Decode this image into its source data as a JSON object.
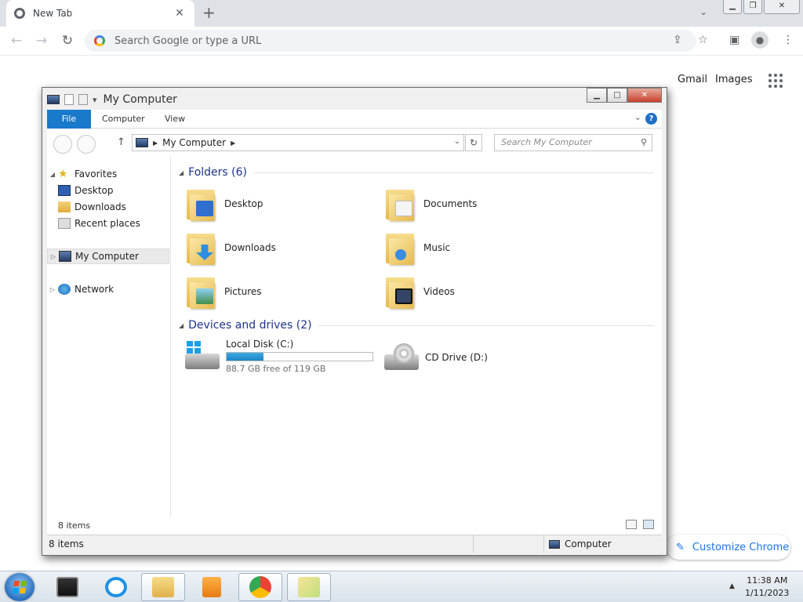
{
  "browser": {
    "tab_title": "New Tab",
    "tab_close": "✕",
    "new_tab": "+",
    "omnibox_placeholder": "Search Google or type a URL",
    "links": {
      "gmail": "Gmail",
      "images": "Images"
    },
    "customize": "Customize Chrome"
  },
  "explorer": {
    "title": "My Computer",
    "ribbon_tabs": [
      "File",
      "Computer",
      "View"
    ],
    "help": "?",
    "address": "My Computer",
    "search_placeholder": "Search My Computer",
    "nav": {
      "favorites": "Favorites",
      "desktop": "Desktop",
      "downloads": "Downloads",
      "recent": "Recent places",
      "computer": "My Computer",
      "network": "Network"
    },
    "folders_header": "Folders (6)",
    "folders": [
      {
        "name": "Desktop",
        "color": "#2f6fd0"
      },
      {
        "name": "Documents",
        "color": "#f5f5f5"
      },
      {
        "name": "Downloads",
        "color": "#2d8fe0"
      },
      {
        "name": "Music",
        "color": "#3a8de0"
      },
      {
        "name": "Pictures",
        "color": "#5aa8e8"
      },
      {
        "name": "Videos",
        "color": "#334466"
      }
    ],
    "drives_header": "Devices and drives (2)",
    "drives": [
      {
        "name": "Local Disk (C:)",
        "free": "88.7 GB free of 119 GB",
        "used_fraction": 0.255
      },
      {
        "name": "CD Drive (D:)"
      }
    ],
    "status_items": "8 items",
    "statusbar_items": "8 items",
    "statusbar_location": "Computer"
  },
  "taskbar": {
    "time": "11:38 AM",
    "date": "1/11/2023"
  }
}
